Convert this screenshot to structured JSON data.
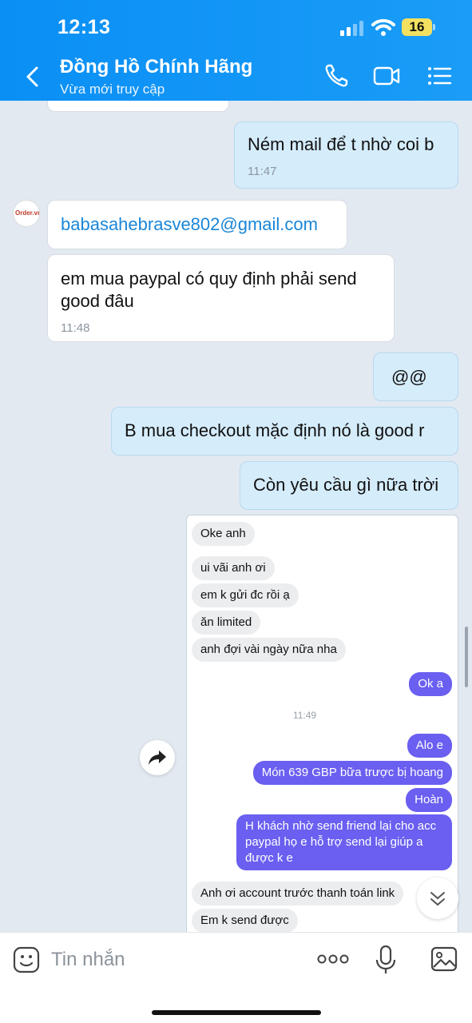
{
  "status": {
    "time": "12:13",
    "battery": "16"
  },
  "header": {
    "title": "Đồng Hồ Chính Hãng",
    "subtitle": "Vừa mới truy cập"
  },
  "avatar": {
    "label": "Order.vn"
  },
  "messages": [
    {
      "text": "Ném mail để t nhờ coi b",
      "time": "11:47"
    },
    {
      "text": "babasahebrasve802@gmail.com"
    },
    {
      "text": "em mua paypal có quy định phải send good đâu",
      "time": "11:48"
    },
    {
      "text": "@@"
    },
    {
      "text": "B mua checkout mặc định nó là good r"
    },
    {
      "text": "Còn yêu cầu gì nữa trời"
    }
  ],
  "screenshot": {
    "time": "11:49",
    "items": [
      "Oke anh",
      "ui vãi anh ơi",
      "em k gửi đc rồi ạ",
      "ăn limited",
      "anh đợi vài ngày nữa nha",
      "Ok a",
      "Alo e",
      "Món 639 GBP bữa trược bị hoang",
      "Hoàn",
      "H khách nhờ send friend lại cho acc paypal họ e hỗ trợ send lại giúp a được k e",
      "Anh ơi account trước thanh toán link",
      "Em k send được"
    ]
  },
  "input": {
    "placeholder": "Tin nhắn"
  },
  "colors": {
    "header": "#0a8ff5",
    "outgoing_bubble": "#d5ecfb",
    "incoming_bubble": "#ffffff",
    "link": "#1a86d8",
    "purple_bubble": "#6a5ff0"
  },
  "icons": [
    "back-icon",
    "phone-icon",
    "video-call-icon",
    "menu-icon",
    "share-icon",
    "scroll-down-icon",
    "sticker-icon",
    "more-icon",
    "microphone-icon",
    "image-icon"
  ]
}
